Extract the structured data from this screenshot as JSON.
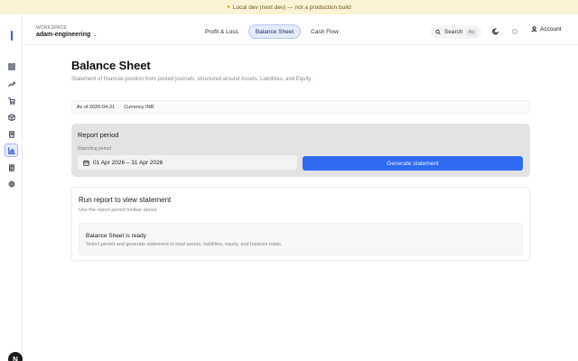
{
  "banner": {
    "text": "Local dev (next dev) — not a production build"
  },
  "sidebar": {
    "items": [
      {
        "name": "dashboard",
        "icon": "grid-icon",
        "active": false
      },
      {
        "name": "trends",
        "icon": "trending-up-icon",
        "active": false
      },
      {
        "name": "cart",
        "icon": "cart-icon",
        "active": false
      },
      {
        "name": "inventory",
        "icon": "box-icon",
        "active": false
      },
      {
        "name": "documents",
        "icon": "document-icon",
        "active": false
      },
      {
        "name": "reports",
        "icon": "bar-chart-icon",
        "active": true
      },
      {
        "name": "ledger",
        "icon": "ledger-icon",
        "active": false
      },
      {
        "name": "settings",
        "icon": "gear-icon",
        "active": false
      }
    ],
    "avatar_letter": "N"
  },
  "topbar": {
    "workspace_label": "WORKSPACE",
    "workspace_name": "adam-engineering",
    "tabs": [
      {
        "label": "Profit & Loss",
        "active": false
      },
      {
        "label": "Balance Sheet",
        "active": true
      },
      {
        "label": "Cash Flow",
        "active": false
      }
    ],
    "search_label": "Search",
    "search_shortcut": "⌘K",
    "account_label": "Account"
  },
  "page": {
    "title": "Balance Sheet",
    "subtitle": "Statement of financial position from posted journals, structured around Assets, Liabilities, and Equity."
  },
  "meta": {
    "as_of": "As of 2026-04-21",
    "currency": "Currency INR"
  },
  "period": {
    "title": "Report period",
    "field_label": "Reporting period",
    "date_range": "01 Apr 2026 – 31 Apr 2026",
    "button_label": "Generate statement"
  },
  "report": {
    "title": "Run report to view statement",
    "subtitle": "Use the report period toolbar above",
    "ready_title": "Balance Sheet is ready",
    "ready_desc": "Select period and generate statement to load assets, liabilities, equity, and balance totals."
  },
  "colors": {
    "accent": "#2f6bf0",
    "active_tab_bg": "#e4ebfb",
    "banner_bg": "#fbf3d6"
  }
}
